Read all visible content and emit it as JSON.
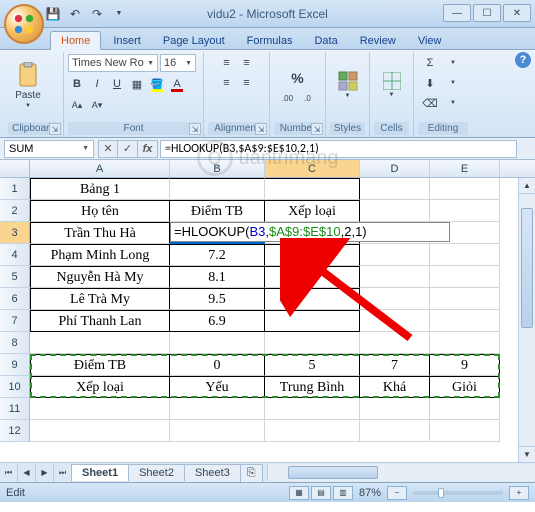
{
  "window": {
    "title": "vidu2 - Microsoft Excel"
  },
  "qat": {
    "save": "💾",
    "undo": "↶",
    "redo": "↷"
  },
  "tabs": [
    "Home",
    "Insert",
    "Page Layout",
    "Formulas",
    "Data",
    "Review",
    "View"
  ],
  "active_tab": "Home",
  "ribbon": {
    "clipboard": {
      "label": "Clipboard",
      "paste": "Paste"
    },
    "font": {
      "label": "Font",
      "name": "Times New Ro",
      "size": "16"
    },
    "alignment": {
      "label": "Alignment"
    },
    "number": {
      "label": "Number",
      "percent": "%"
    },
    "styles": {
      "label": "Styles"
    },
    "cells": {
      "label": "Cells"
    },
    "editing": {
      "label": "Editing",
      "sigma": "Σ"
    }
  },
  "namebox": "SUM",
  "formula_bar": "=HLOOKUP(B3,$A$9:$E$10,2,1)",
  "editing_formula": {
    "pre": "=HLOOKUP(",
    "ref1": "B3",
    "mid": ",",
    "ref2": "$A$9:$E$10",
    "post": ",2,1)"
  },
  "columns": [
    "A",
    "B",
    "C",
    "D",
    "E"
  ],
  "grid": {
    "r1": {
      "A": "Bảng 1"
    },
    "r2": {
      "A": "Họ tên",
      "B": "Điểm TB",
      "C": "Xếp loại"
    },
    "r3": {
      "A": "Trần Thu Hà"
    },
    "r4": {
      "A": "Phạm Minh Long",
      "B": "7.2"
    },
    "r5": {
      "A": "Nguyễn Hà My",
      "B": "8.1"
    },
    "r6": {
      "A": "Lê Trà My",
      "B": "9.5"
    },
    "r7": {
      "A": "Phí Thanh Lan",
      "B": "6.9"
    },
    "r9": {
      "A": "Điểm TB",
      "B": "0",
      "C": "5",
      "D": "7",
      "E": "9"
    },
    "r10": {
      "A": "Xếp loại",
      "B": "Yếu",
      "C": "Trung Bình",
      "D": "Khá",
      "E": "Giỏi"
    }
  },
  "sheets": [
    "Sheet1",
    "Sheet2",
    "Sheet3"
  ],
  "active_sheet": "Sheet1",
  "status": {
    "mode": "Edit",
    "zoom": "87%"
  },
  "watermark_text": "uantrimang"
}
